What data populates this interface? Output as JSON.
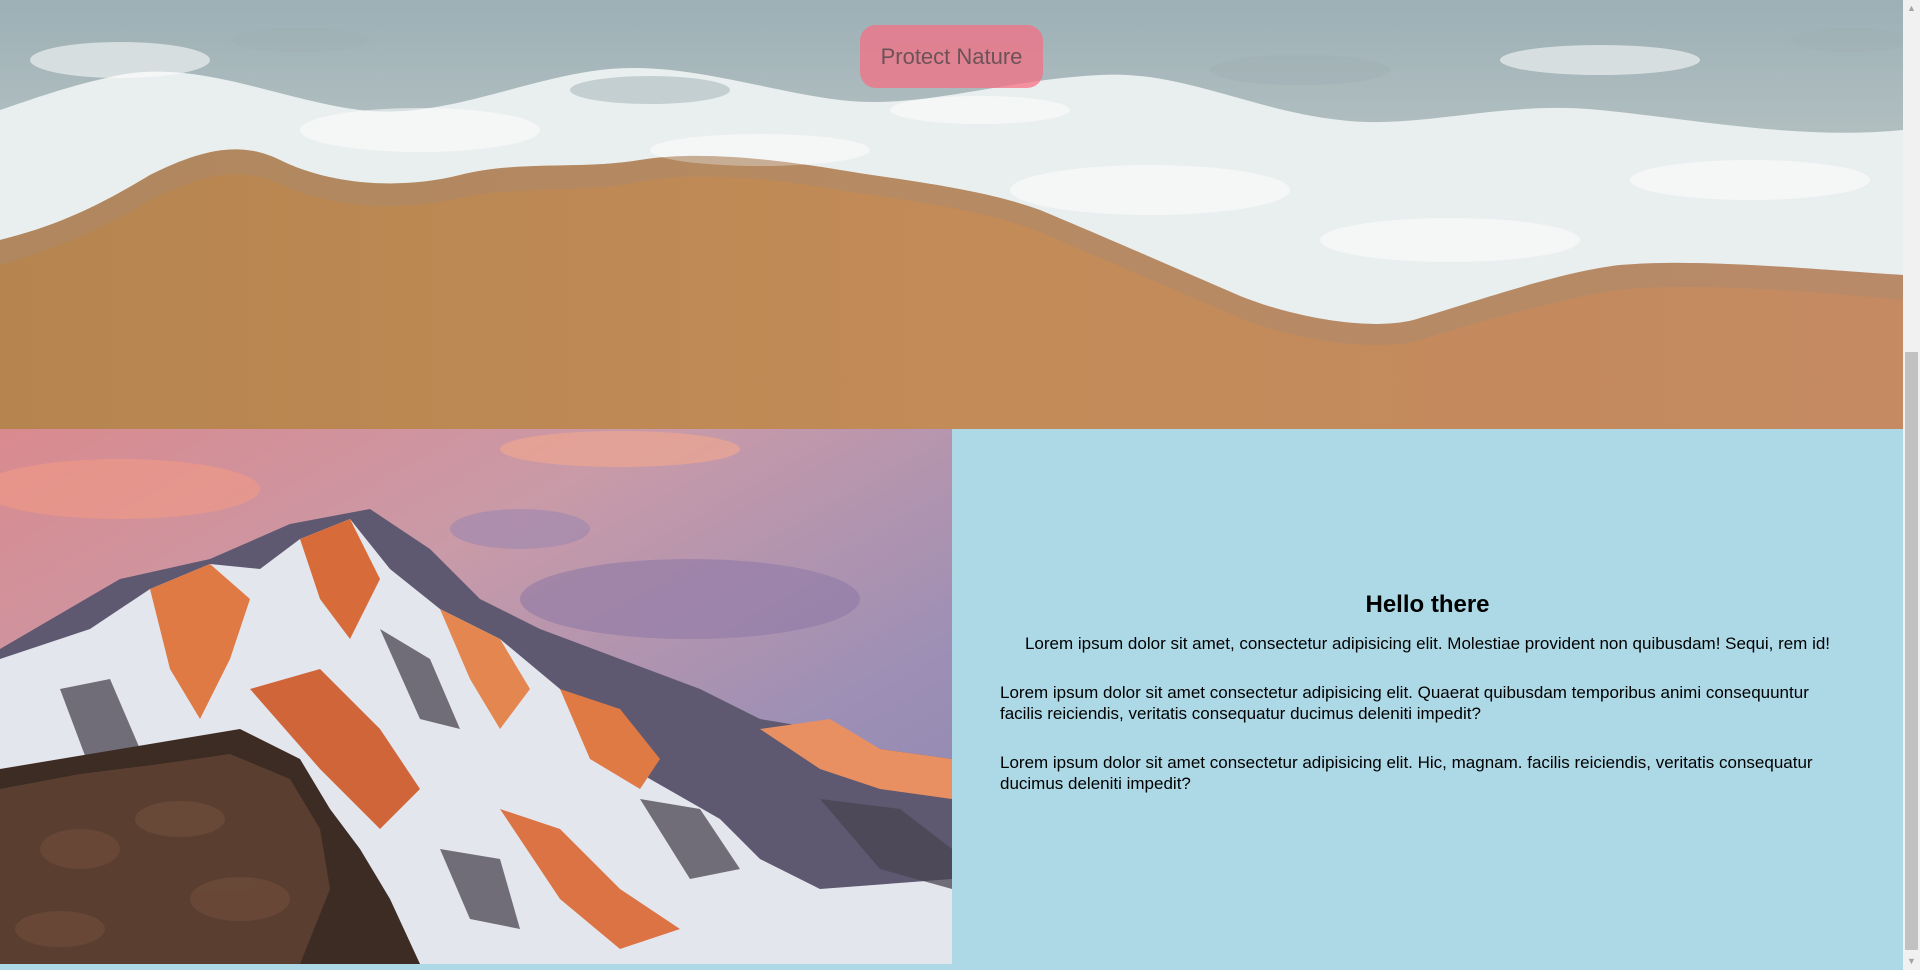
{
  "hero": {
    "button_label": "Protect Nature"
  },
  "section": {
    "heading": "Hello there",
    "intro": "Lorem ipsum dolor sit amet, consectetur adipisicing elit. Molestiae provident non quibusdam! Sequi, rem id!",
    "paragraphs": [
      "Lorem ipsum dolor sit amet consectetur adipisicing elit. Quaerat quibusdam temporibus animi consequuntur facilis reiciendis, veritatis consequatur ducimus deleniti impedit?",
      "Lorem ipsum dolor sit amet consectetur adipisicing elit. Hic, magnam. facilis reiciendis, veritatis consequatur ducimus deleniti impedit?"
    ]
  },
  "images": {
    "hero": "beach-waves-aerial-image",
    "side": "snowy-mountain-sunset-image"
  },
  "colors": {
    "panel_background": "#add8e6",
    "button_background": "#f66e82",
    "sand": "#c08a55",
    "foam": "#eef2f2"
  },
  "icons": {
    "scroll_up": "triangle-up-icon",
    "scroll_down": "triangle-down-icon"
  }
}
